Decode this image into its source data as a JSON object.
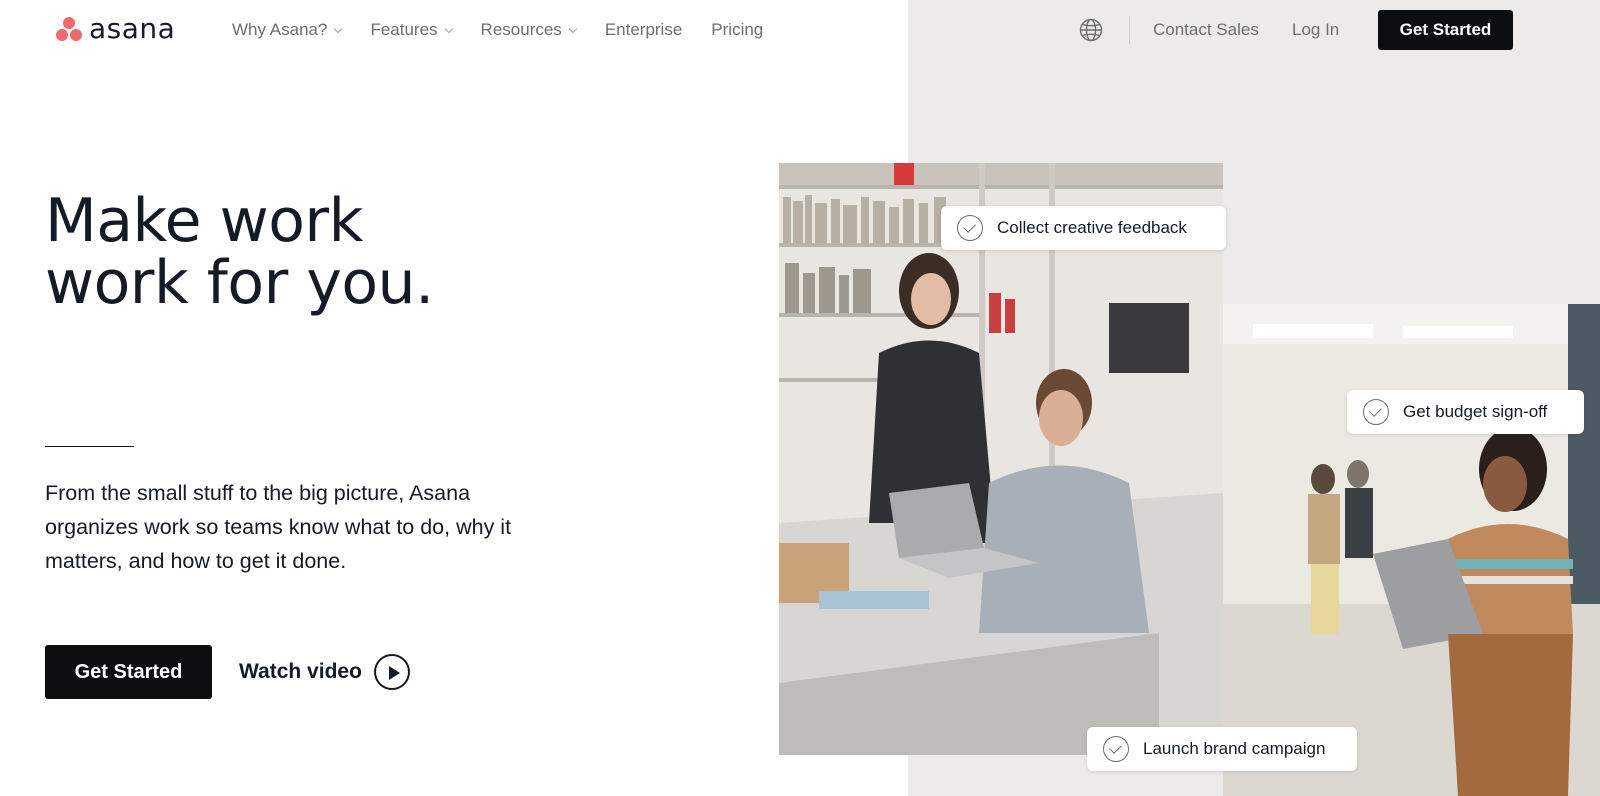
{
  "brand": {
    "logo_text": "asana",
    "accent": "#f06a6a"
  },
  "nav": {
    "items": [
      {
        "label": "Why Asana?",
        "has_dropdown": true
      },
      {
        "label": "Features",
        "has_dropdown": true
      },
      {
        "label": "Resources",
        "has_dropdown": true
      },
      {
        "label": "Enterprise",
        "has_dropdown": false
      },
      {
        "label": "Pricing",
        "has_dropdown": false
      }
    ],
    "language_icon": "globe-icon",
    "contact_sales": "Contact Sales",
    "log_in": "Log In",
    "cta": "Get Started"
  },
  "hero": {
    "title_line1": "Make work",
    "title_line2": "work for you.",
    "subtitle": "From the small stuff to the big picture, Asana organizes work so teams know what to do, why it matters, and how to get it done.",
    "cta": "Get Started",
    "watch_video": "Watch video"
  },
  "tasks": [
    {
      "label": "Collect creative feedback"
    },
    {
      "label": "Get budget sign-off"
    },
    {
      "label": "Launch brand campaign"
    }
  ],
  "colors": {
    "dark_button": "#0d0e10",
    "panel_bg": "#ecebea",
    "text": "#151b26",
    "muted_text": "#6d6e6f"
  }
}
